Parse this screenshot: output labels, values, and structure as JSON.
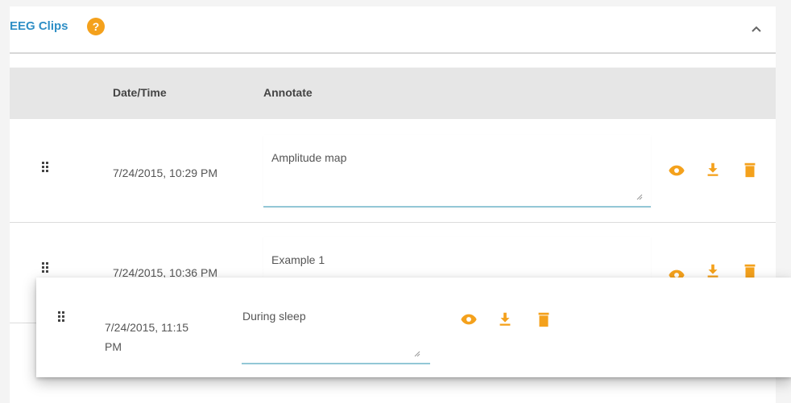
{
  "panel": {
    "title": "EEG Clips",
    "help_icon_glyph": "?",
    "accent_color": "#2f8fc6",
    "action_color": "#f4a11c"
  },
  "table": {
    "columns": [
      "Date/Time",
      "Annotate"
    ]
  },
  "rows": [
    {
      "datetime": "7/24/2015, 10:29 PM",
      "annotation": "Amplitude map"
    },
    {
      "datetime": "7/24/2015, 10:36 PM",
      "annotation": "Example 1"
    }
  ],
  "dragging_row": {
    "datetime_line1": "7/24/2015, 11:15",
    "datetime_line2": "PM",
    "annotation": "During sleep"
  },
  "icons": {
    "handle": "drag-handle-icon",
    "view": "eye-icon",
    "download": "download-icon",
    "delete": "trash-icon",
    "collapse": "chevron-up-icon",
    "help": "help-icon"
  }
}
